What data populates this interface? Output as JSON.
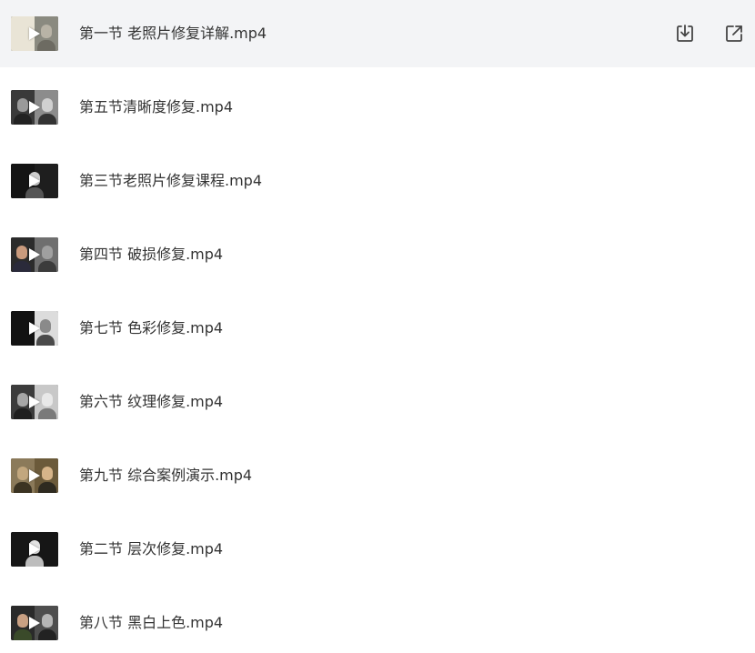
{
  "files": [
    {
      "name": "第一节 老照片修复详解.mp4",
      "active": true,
      "thumb_icon": "video-thumbnail",
      "actions": {
        "download_icon": "download-icon",
        "open_icon": "open-external-icon"
      }
    },
    {
      "name": "第五节清晰度修复.mp4",
      "active": false,
      "thumb_icon": "video-thumbnail"
    },
    {
      "name": "第三节老照片修复课程.mp4",
      "active": false,
      "thumb_icon": "video-thumbnail"
    },
    {
      "name": "第四节 破损修复.mp4",
      "active": false,
      "thumb_icon": "video-thumbnail"
    },
    {
      "name": "第七节 色彩修复.mp4",
      "active": false,
      "thumb_icon": "video-thumbnail"
    },
    {
      "name": "第六节 纹理修复.mp4",
      "active": false,
      "thumb_icon": "video-thumbnail"
    },
    {
      "name": "第九节 综合案例演示.mp4",
      "active": false,
      "thumb_icon": "video-thumbnail"
    },
    {
      "name": "第二节 层次修复.mp4",
      "active": false,
      "thumb_icon": "video-thumbnail"
    },
    {
      "name": "第八节 黑白上色.mp4",
      "active": false,
      "thumb_icon": "video-thumbnail"
    }
  ],
  "colors": {
    "active_row_bg": "#f3f4f6",
    "text": "#333333",
    "icon": "#444444"
  }
}
